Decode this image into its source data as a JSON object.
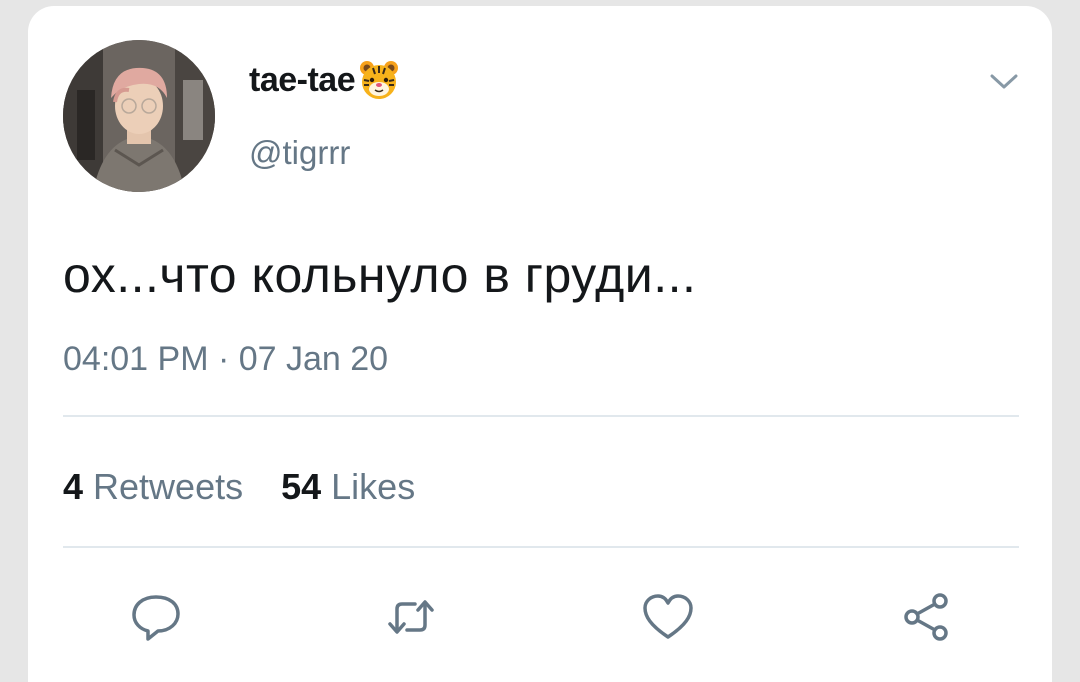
{
  "tweet": {
    "display_name": "tae-tae",
    "handle": "@tigrrr",
    "text": "ох...что кольнуло в груди...",
    "timestamp": "04:01 PM · 07 Jan 20",
    "retweets_count": "4",
    "retweets_label": "Retweets",
    "likes_count": "54",
    "likes_label": "Likes"
  },
  "icons": {
    "name_emoji": "tiger-face-icon",
    "menu": "chevron-down-icon",
    "actions": [
      "reply-icon",
      "retweet-icon",
      "like-icon",
      "share-icon"
    ]
  },
  "colors": {
    "text_primary": "#14171a",
    "text_secondary": "#657786",
    "divider": "#e1e8ed",
    "icon": "#657786"
  }
}
